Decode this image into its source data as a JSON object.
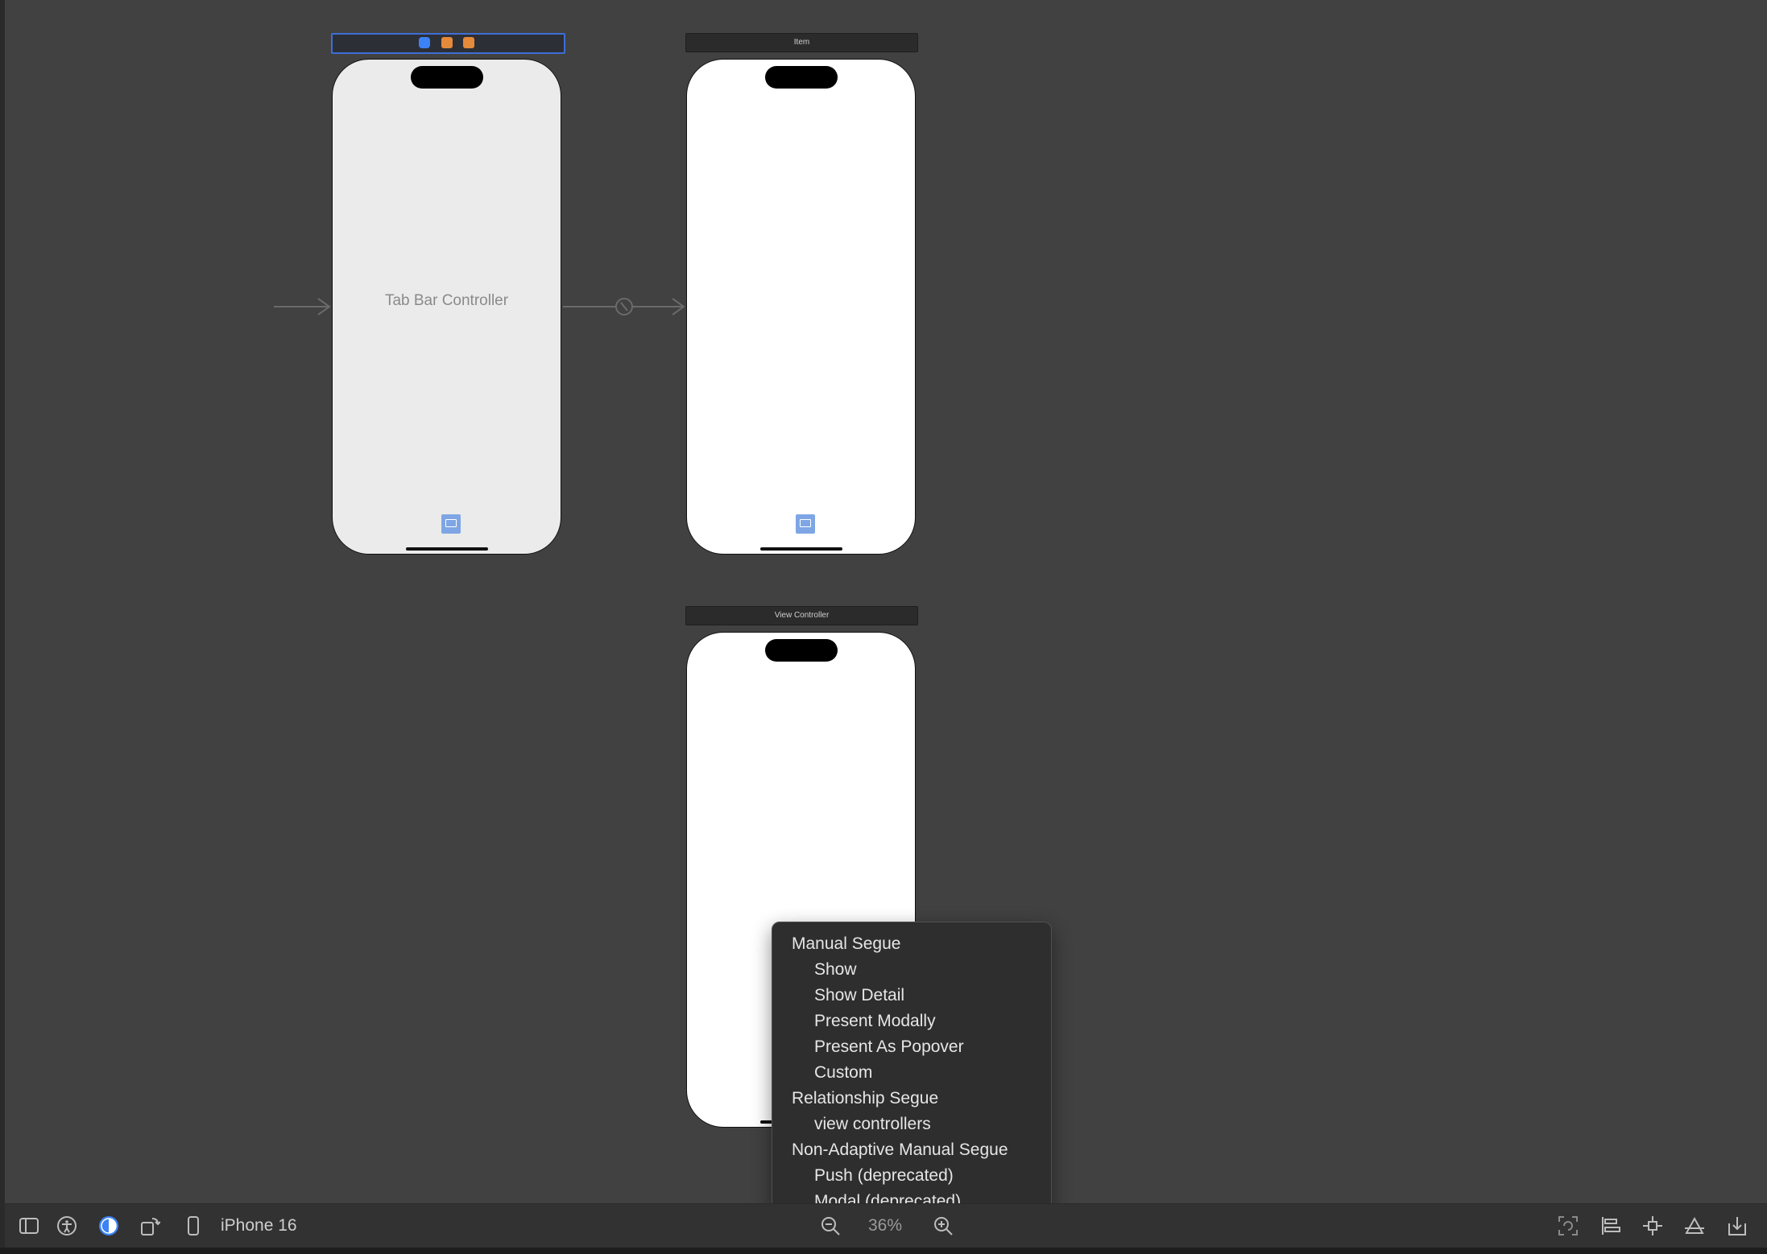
{
  "scenes": {
    "tab_bar_controller": {
      "label": "Tab Bar Controller"
    },
    "item": {
      "title": "Item"
    },
    "view_controller": {
      "title": "View Controller"
    }
  },
  "segue_menu": {
    "sections": [
      {
        "label": "Manual Segue",
        "items": [
          "Show",
          "Show Detail",
          "Present Modally",
          "Present As Popover",
          "Custom"
        ]
      },
      {
        "label": "Relationship Segue",
        "items": [
          "view controllers"
        ]
      },
      {
        "label": "Non-Adaptive Manual Segue",
        "items": [
          "Push (deprecated)",
          "Modal (deprecated)"
        ]
      }
    ]
  },
  "toolbar": {
    "device": "iPhone 16",
    "zoom": "36%"
  },
  "colors": {
    "canvas": "#414141",
    "accent": "#3d6fd6",
    "tab_bar_scene": "#ebebeb",
    "view_scene": "#ffffff"
  }
}
